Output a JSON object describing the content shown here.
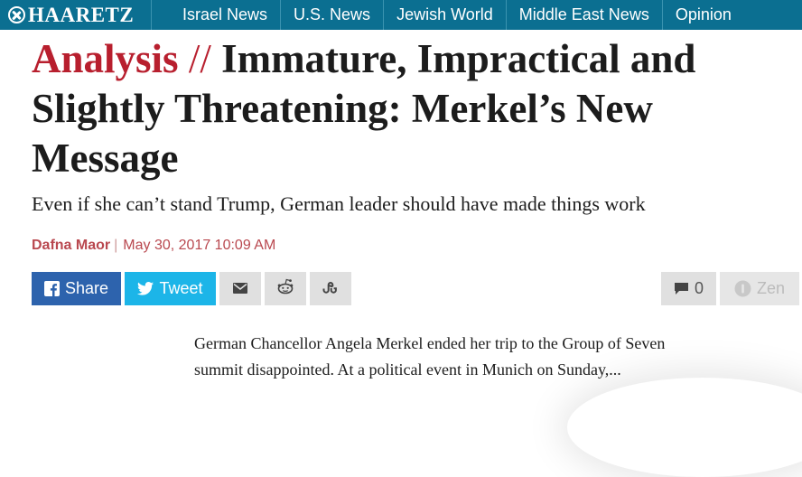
{
  "brand": {
    "logo_text": "HAARETZ"
  },
  "nav": {
    "items": [
      "Israel News",
      "U.S. News",
      "Jewish World",
      "Middle East News",
      "Opinion"
    ]
  },
  "article": {
    "kicker": "Analysis",
    "separator": "//",
    "title": "Immature, Impractical and Slightly Threatening: Merkel’s New Message",
    "subtitle": "Even if she can’t stand Trump, German leader should have made things work",
    "author": "Dafna Maor",
    "byline_separator": "|",
    "date": "May 30, 2017 10:09 AM",
    "teaser": "German Chancellor Angela Merkel ended her trip to the Group of Seven summit disappointed. At a political event in Munich on Sunday,..."
  },
  "share": {
    "share_label": "Share",
    "tweet_label": "Tweet",
    "comments_count": "0",
    "zen_label": "Zen",
    "icons": [
      "facebook-icon",
      "twitter-icon",
      "email-icon",
      "reddit-icon",
      "stumbleupon-icon",
      "comment-icon",
      "zen-icon"
    ],
    "colors": {
      "facebook": "#2d63ad",
      "twitter": "#1cb5e8",
      "neutral": "#e0e0e0"
    }
  },
  "colors": {
    "topbar": "#0b6f91",
    "kicker": "#b81f2e",
    "byline": "#b9484f"
  }
}
